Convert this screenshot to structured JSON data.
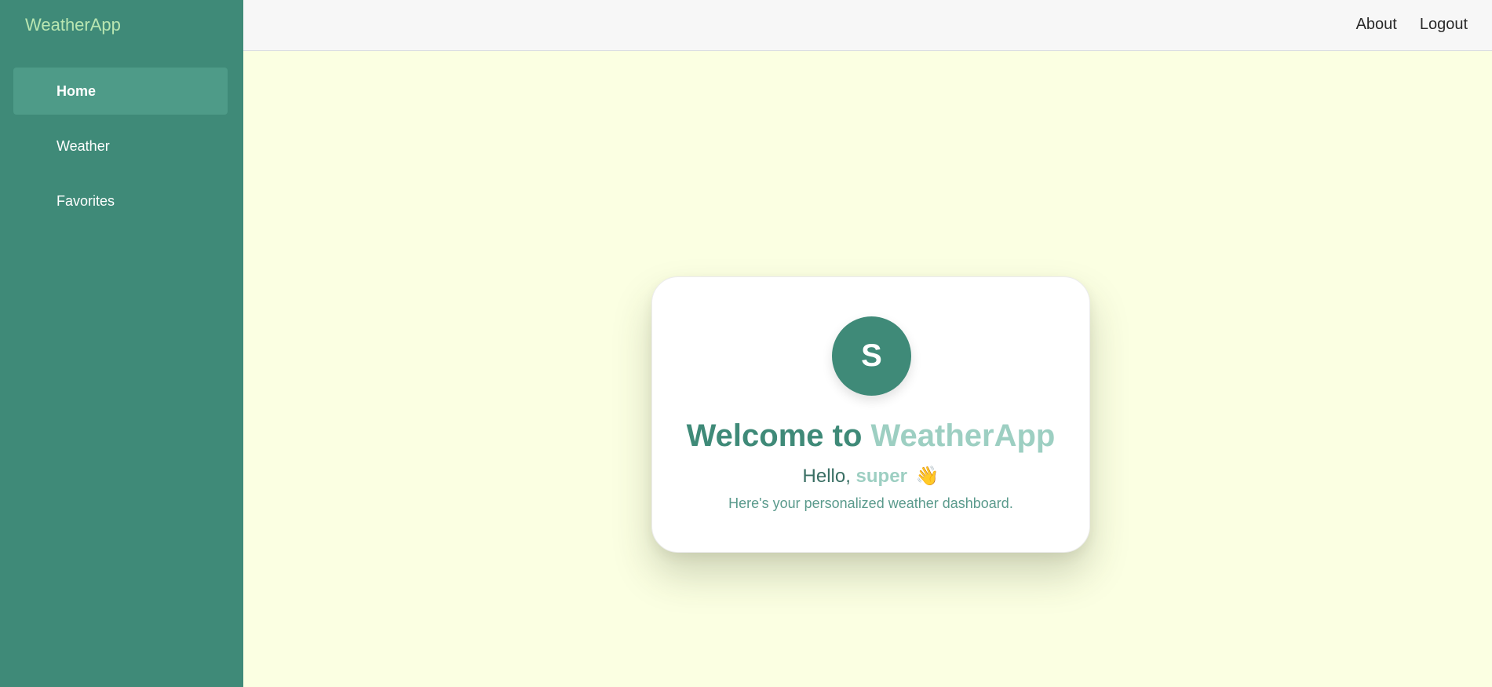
{
  "app": {
    "brand": "WeatherApp"
  },
  "sidebar": {
    "items": [
      {
        "label": "Home",
        "active": true
      },
      {
        "label": "Weather",
        "active": false
      },
      {
        "label": "Favorites",
        "active": false
      }
    ]
  },
  "topbar": {
    "links": [
      "About",
      "Logout"
    ]
  },
  "card": {
    "avatar_initial": "S",
    "welcome_prefix": "Welcome to ",
    "welcome_app": "WeatherApp",
    "hello_prefix": "Hello, ",
    "username": "super",
    "wave_emoji": "👋",
    "subtitle": "Here's your personalized weather dashboard."
  },
  "colors": {
    "sidebar_bg": "#3f8a78",
    "active_item_bg": "#4e9b88",
    "brand_text": "#b9e6b1",
    "page_bg": "#fbffe2",
    "accent_light": "#9dcfc2"
  },
  "icons": {
    "wave": "waving-hand-icon"
  }
}
